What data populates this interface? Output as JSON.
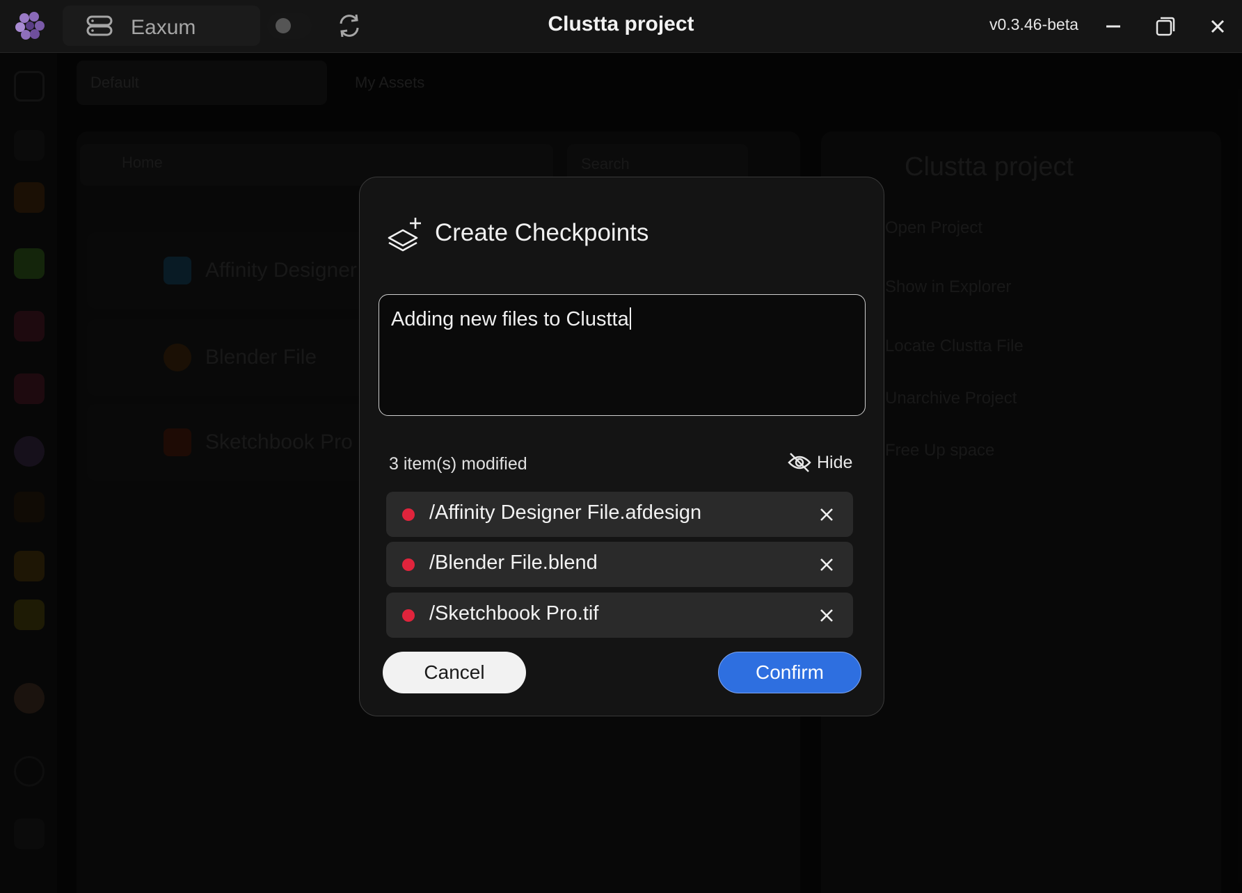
{
  "titlebar": {
    "workspace": "Eaxum",
    "title": "Clustta project",
    "version": "v0.3.46-beta"
  },
  "background": {
    "tabs": [
      "Default",
      "My Assets"
    ],
    "breadcrumb": "Home",
    "search_placeholder": "Search",
    "files": [
      "Affinity Designer File",
      "Blender File",
      "Sketchbook Pro"
    ],
    "project_name": "Clustta project",
    "menu": [
      "Open Project",
      "Show in Explorer",
      "Locate Clustta File",
      "Unarchive Project",
      "Free Up space"
    ]
  },
  "dialog": {
    "title": "Create Checkpoints",
    "message": "Adding new files to Clustta",
    "modified_count": "3 item(s) modified",
    "hide_label": "Hide",
    "files": [
      {
        "path": "/Affinity Designer File.afdesign"
      },
      {
        "path": "/Blender File.blend"
      },
      {
        "path": "/Sketchbook Pro.tif"
      }
    ],
    "cancel_label": "Cancel",
    "confirm_label": "Confirm"
  },
  "colors": {
    "accent": "#2e6fe0",
    "modified_dot": "#e0243c"
  },
  "icons": {
    "app": "clustta-flower-icon",
    "workspace": "database-icon",
    "sync": "refresh-icon",
    "dialog": "layers-plus-icon",
    "hide": "eye-off-icon",
    "remove": "close-icon"
  }
}
